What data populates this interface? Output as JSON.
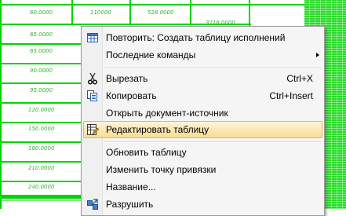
{
  "table": {
    "col1": [
      "60.0000",
      "65.0000",
      "65.0000",
      "90.0000",
      "95.0000",
      "120.0000",
      "150.0000",
      "180.0000",
      "210.0000",
      "240.0000"
    ],
    "col2_top": "110000",
    "col3_top": "528.0000",
    "col4_top": "3716.0000"
  },
  "menu": {
    "items": [
      {
        "label": "Повторить: Создать таблицу исполнений",
        "shortcut": "",
        "icon": "table-grid-icon",
        "submenu": false
      },
      {
        "label": "Последние команды",
        "shortcut": "",
        "icon": "",
        "submenu": true
      },
      {
        "label": "Вырезать",
        "shortcut": "Ctrl+X",
        "icon": "scissors-icon",
        "submenu": false
      },
      {
        "label": "Копировать",
        "shortcut": "Ctrl+Insert",
        "icon": "copy-icon",
        "submenu": false
      },
      {
        "label": "Открыть документ-источник",
        "shortcut": "",
        "icon": "",
        "submenu": false
      },
      {
        "label": "Редактировать таблицу",
        "shortcut": "",
        "icon": "edit-table-icon",
        "submenu": false,
        "highlighted": true
      },
      {
        "label": "Обновить таблицу",
        "shortcut": "",
        "icon": "",
        "submenu": false
      },
      {
        "label": "Изменить точку привязки",
        "shortcut": "",
        "icon": "",
        "submenu": false
      },
      {
        "label": "Название...",
        "shortcut": "",
        "icon": "",
        "submenu": false
      },
      {
        "label": "Разрушить",
        "shortcut": "",
        "icon": "explode-icon",
        "submenu": false
      }
    ]
  },
  "colors": {
    "drawing_green": "#00d400",
    "hatch_green": "#2ad62a",
    "menu_bg": "#f5f5f5",
    "highlight_border": "#e5b949"
  }
}
